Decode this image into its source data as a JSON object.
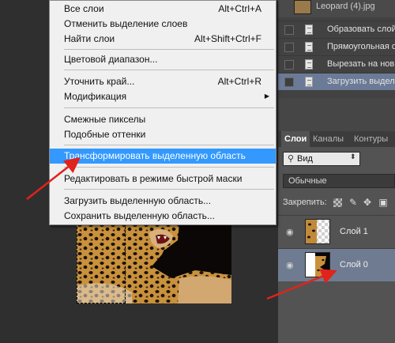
{
  "history": {
    "snapshot_label": "Leopard (4).jpg",
    "items": [
      {
        "label": "Образовать слой",
        "active": false
      },
      {
        "label": "Прямоугольная обл",
        "active": false
      },
      {
        "label": "Вырезать на новый",
        "active": false
      },
      {
        "label": "Загрузить выделе",
        "active": true
      }
    ]
  },
  "menu": {
    "items": [
      {
        "label": "Все слои",
        "shortcut": "Alt+Ctrl+A"
      },
      {
        "label": "Отменить выделение слоев",
        "shortcut": ""
      },
      {
        "label": "Найти слои",
        "shortcut": "Alt+Shift+Ctrl+F"
      },
      {
        "label": "Цветовой диапазон...",
        "shortcut": ""
      },
      {
        "label": "Уточнить край...",
        "shortcut": "Alt+Ctrl+R"
      },
      {
        "label": "Модификация",
        "shortcut": ""
      },
      {
        "label": "Смежные пикселы",
        "shortcut": ""
      },
      {
        "label": "Подобные оттенки",
        "shortcut": ""
      },
      {
        "label": "Трансформировать выделенную область",
        "shortcut": "",
        "highlighted": true
      },
      {
        "label": "Редактировать в режиме быстрой маски",
        "shortcut": ""
      },
      {
        "label": "Загрузить выделенную область...",
        "shortcut": ""
      },
      {
        "label": "Сохранить выделенную область...",
        "shortcut": ""
      }
    ]
  },
  "layers": {
    "tabs": [
      "Слои",
      "Каналы",
      "Контуры"
    ],
    "kind_value": "Вид",
    "blend_mode": "Обычные",
    "lock_label": "Закрепить:",
    "items": [
      {
        "name": "Слой 1",
        "selected": false
      },
      {
        "name": "Слой 0",
        "selected": true
      }
    ]
  },
  "colors": {
    "highlight": "#3399ff",
    "arrow": "#e0231c",
    "selected_layer": "#6f7b90"
  }
}
